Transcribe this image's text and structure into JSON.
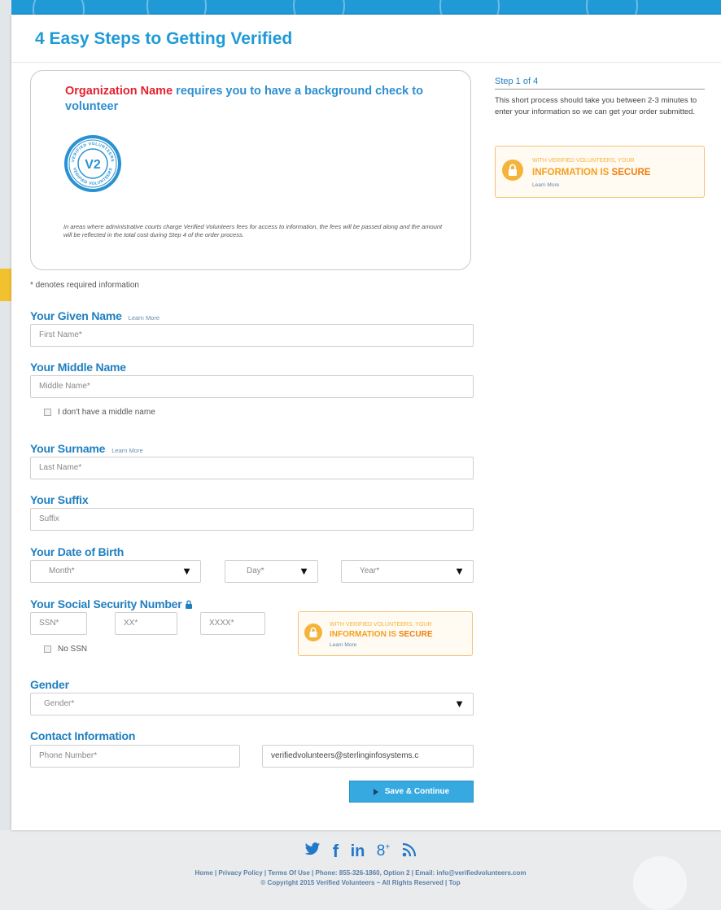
{
  "page": {
    "title": "4 Easy Steps to Getting Verified",
    "org_name": "Organization Name",
    "org_requirement": "requires you to have a background check to volunteer",
    "disclaimer": "In areas where administrative courts charge Verified Volunteers fees for access to information, the fees will be passed along and the amount will be reflected in the total cost during Step 4 of the order process.",
    "required_note": "* denotes required information"
  },
  "badge": {
    "ring_top": "VERIFIED VOLUNTEERS",
    "ring_bottom": "VERIFIED VOLUNTEERS",
    "mark": "V2"
  },
  "form": {
    "given_name": {
      "label": "Your Given Name",
      "learn_more": "Learn More",
      "placeholder": "First Name*"
    },
    "middle_name": {
      "label": "Your Middle Name",
      "placeholder": "Middle Name*",
      "no_middle": "I don't have a middle name"
    },
    "surname": {
      "label": "Your Surname",
      "learn_more": "Learn More",
      "placeholder": "Last Name*"
    },
    "suffix": {
      "label": "Your Suffix",
      "placeholder": "Suffix"
    },
    "dob": {
      "label": "Your Date of Birth",
      "month": "Month*",
      "day": "Day*",
      "year": "Year*"
    },
    "ssn": {
      "label": "Your Social Security Number",
      "part1": "SSN*",
      "part2": "XX*",
      "part3": "XXXX*",
      "no_ssn": "No SSN"
    },
    "gender": {
      "label": "Gender",
      "placeholder": "Gender*"
    },
    "contact": {
      "label": "Contact Information",
      "phone": "Phone Number*",
      "email": "verifiedvolunteers@sterlinginfosystems.c"
    },
    "save_label": "Save & Continue"
  },
  "secure_badge": {
    "line1": "WITH VERIFIED VOLUNTEERS, YOUR",
    "line2_a": "INFORMATION IS",
    "line2_b": "SECURE",
    "learn_more": "Learn More"
  },
  "sidebar": {
    "step": "Step 1 of 4",
    "description": "This short process should take you between 2-3 minutes to enter your information so we can get your order submitted."
  },
  "footer": {
    "links": "Home | Privacy Policy | Terms Of Use | Phone: 855-326-1860, Option 2 | Email: info@verifiedvolunteers.com",
    "copyright": "© Copyright 2015 Verified Volunteers ~ All Rights Reserved | Top",
    "social_icons": [
      "twitter-icon",
      "facebook-icon",
      "linkedin-icon",
      "google-plus-icon",
      "rss-icon"
    ]
  },
  "colors": {
    "accent": "#1f9ad6",
    "org_red": "#e4222e",
    "secure_orange": "#f4b43c",
    "button": "#36a9e1"
  }
}
